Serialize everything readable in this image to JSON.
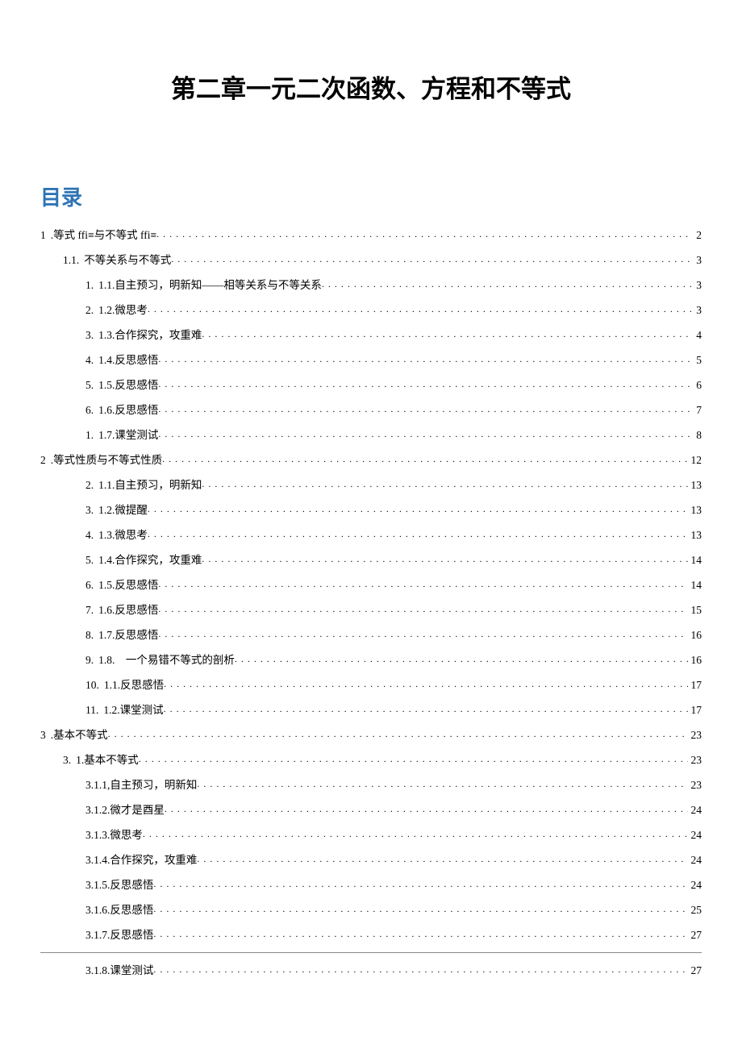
{
  "chapter_title": "第二章一元二次函数、方程和不等式",
  "toc_heading": "目录",
  "entries": [
    {
      "level": 0,
      "lead": "1",
      "text": ".等式 ffi≡与不等式 ffi≡",
      "page": "2"
    },
    {
      "level": 1,
      "lead": "1.1.",
      "text": "不等关系与不等式",
      "page": "3"
    },
    {
      "level": 2,
      "lead": "1.",
      "text": "1.1.自主预习，明新知——相等关系与不等关系",
      "page": "3"
    },
    {
      "level": 2,
      "lead": "2.",
      "text": "1.2.微思考",
      "page": "3"
    },
    {
      "level": 2,
      "lead": "3.",
      "text": "1.3.合作探究，攻重难",
      "page": "4"
    },
    {
      "level": 2,
      "lead": "4.",
      "text": "1.4.反思感悟",
      "page": "5"
    },
    {
      "level": 2,
      "lead": "5.",
      "text": "1.5.反思感悟",
      "page": "6"
    },
    {
      "level": 2,
      "lead": "6.",
      "text": "1.6.反思感悟",
      "page": "7"
    },
    {
      "level": 2,
      "lead": "1.",
      "text": "1.7.课堂测试",
      "page": "8"
    },
    {
      "level": 0,
      "lead": "2",
      "text": ".等式性质与不等式性质",
      "page": "12"
    },
    {
      "level": 2,
      "lead": "2.",
      "text": "1.1.自主预习，明新知",
      "page": "13"
    },
    {
      "level": 2,
      "lead": "3.",
      "text": "1.2.微提醒",
      "page": "13"
    },
    {
      "level": 2,
      "lead": "4.",
      "text": "1.3.微思考",
      "page": "13"
    },
    {
      "level": 2,
      "lead": "5.",
      "text": "1.4.合作探究，攻重难",
      "page": "14"
    },
    {
      "level": 2,
      "lead": "6.",
      "text": "1.5.反思感悟",
      "page": "14"
    },
    {
      "level": 2,
      "lead": "7.",
      "text": "1.6.反思感悟",
      "page": "15"
    },
    {
      "level": 2,
      "lead": "8.",
      "text": "1.7.反思感悟",
      "page": "16"
    },
    {
      "level": 2,
      "lead": "9.",
      "text": "1.8.　一个易错不等式的剖析",
      "page": "16"
    },
    {
      "level": 2,
      "lead": "10.",
      "text": "1.1.反思感悟",
      "page": "17"
    },
    {
      "level": 2,
      "lead": "11.",
      "text": "1.2.课堂测试",
      "page": "17"
    },
    {
      "level": 0,
      "lead": "3",
      "text": ".基本不等式",
      "page": "23"
    },
    {
      "level": 1,
      "lead": "3.",
      "text": "1.基本不等式",
      "page": "23"
    },
    {
      "level": "2b",
      "lead": "",
      "text": "3.1.1,自主预习，明新知",
      "page": "23"
    },
    {
      "level": "2b",
      "lead": "",
      "text": "3.1.2.微才是酉星",
      "page": "24"
    },
    {
      "level": "2b",
      "lead": "",
      "text": "3.1.3.微思考",
      "page": "24"
    },
    {
      "level": "2b",
      "lead": "",
      "text": "3.1.4.合作探究，攻重难",
      "page": "24"
    },
    {
      "level": "2b",
      "lead": "",
      "text": "3.1.5.反思感悟",
      "page": "24"
    },
    {
      "level": "2b",
      "lead": "",
      "text": "3.1.6.反思感悟",
      "page": "25"
    },
    {
      "level": "2b",
      "lead": "",
      "text": "3.1.7.反思感悟",
      "page": "27",
      "hr_after": true
    },
    {
      "level": "2b",
      "lead": "",
      "text": "3.1.8.课堂测试",
      "page": "27"
    }
  ]
}
